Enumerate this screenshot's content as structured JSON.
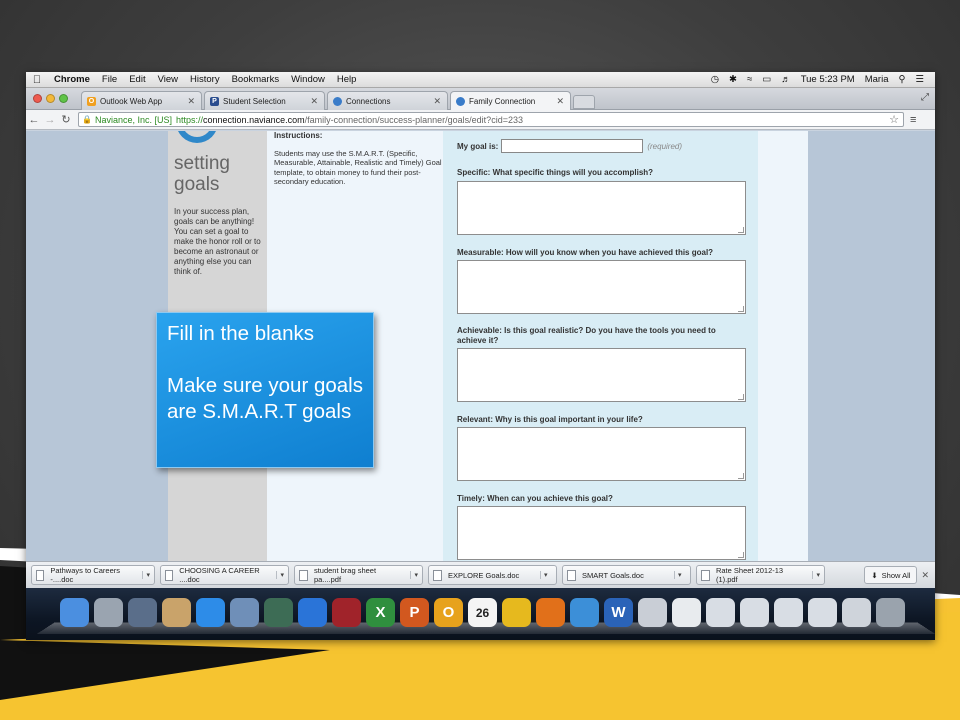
{
  "menubar": {
    "app": "Chrome",
    "items": [
      "File",
      "Edit",
      "View",
      "History",
      "Bookmarks",
      "Window",
      "Help"
    ],
    "clock": "Tue 5:23 PM",
    "user": "Maria"
  },
  "tabs": [
    {
      "label": "Outlook Web App",
      "icon": "outlook-icon",
      "color": "#f0a020"
    },
    {
      "label": "Student Selection",
      "icon": "p-icon",
      "color": "#2a4d8f"
    },
    {
      "label": "Connections",
      "icon": "globe-icon",
      "color": "#3a7cc9"
    },
    {
      "label": "Family Connection",
      "icon": "globe-icon",
      "color": "#3a7cc9"
    }
  ],
  "omnibox": {
    "secure_label": "Naviance, Inc. [US]",
    "scheme": "https://",
    "host": "connection.naviance.com",
    "path": "/family-connection/success-planner/goals/edit?cid=233"
  },
  "sidebar": {
    "heading_line1": "setting",
    "heading_line2": "goals",
    "text": "In your success plan, goals can be anything! You can set a goal to make the honor roll or to become an astronaut or anything else you can think of."
  },
  "instructions": {
    "title": "Instructions:",
    "body": "Students may use the S.M.A.R.T. (Specific, Measurable, Attainable, Realistic and Timely) Goal template, to obtain money to fund their post-secondary education."
  },
  "form": {
    "goal_label": "My goal is:",
    "required": "(required)",
    "questions": [
      "Specific: What specific things will you accomplish?",
      "Measurable: How will you know when you have achieved this goal?",
      "Achievable: Is this goal realistic? Do you have the tools you need to achieve it?",
      "Relevant: Why is this goal important in your life?",
      "Timely: When can you achieve this goal?"
    ]
  },
  "callout": {
    "line1": "Fill in the blanks",
    "line2": "Make sure your goals are S.M.A.R.T goals"
  },
  "downloads": {
    "files": [
      "Pathways to Careers -....doc",
      "CHOOSING A CAREER ....doc",
      "student brag sheet pa....pdf",
      "EXPLORE Goals.doc",
      "SMART Goals.doc",
      "Rate Sheet 2012-13 (1).pdf"
    ],
    "show_all": "Show All"
  },
  "dock": {
    "icons": [
      {
        "name": "finder-icon",
        "color": "#4b8fe0"
      },
      {
        "name": "launchpad-icon",
        "color": "#9aa4b0"
      },
      {
        "name": "mission-control-icon",
        "color": "#5a6e8a"
      },
      {
        "name": "contacts-icon",
        "color": "#c9a36a"
      },
      {
        "name": "app-store-icon",
        "color": "#2d8ce8"
      },
      {
        "name": "preview-icon",
        "color": "#6f8fb8"
      },
      {
        "name": "facetime-icon",
        "color": "#3d6c55"
      },
      {
        "name": "itunes-icon",
        "color": "#2a74d8"
      },
      {
        "name": "photo-booth-icon",
        "color": "#a0232a"
      },
      {
        "name": "excel-icon",
        "color": "#2f8f3e",
        "glyph": "X"
      },
      {
        "name": "powerpoint-icon",
        "color": "#d2581f",
        "glyph": "P"
      },
      {
        "name": "outlook-icon",
        "color": "#e7a21c",
        "glyph": "O"
      },
      {
        "name": "calendar-icon",
        "color": "#f4f4f4",
        "glyph": "26"
      },
      {
        "name": "chrome-icon",
        "color": "#e6b91e"
      },
      {
        "name": "firefox-icon",
        "color": "#e1701a"
      },
      {
        "name": "safari-icon",
        "color": "#3c8fd8"
      },
      {
        "name": "word-icon",
        "color": "#2a63b8",
        "glyph": "W"
      },
      {
        "name": "documents-stack-icon",
        "color": "#c9ced6"
      },
      {
        "name": "document-icon",
        "color": "#e8ebee"
      },
      {
        "name": "document-stack-icon",
        "color": "#d8dde4"
      },
      {
        "name": "document-stack-icon",
        "color": "#d8dde4"
      },
      {
        "name": "document-stack-icon",
        "color": "#d8dde4"
      },
      {
        "name": "document-stack-icon",
        "color": "#d8dde4"
      },
      {
        "name": "downloads-stack-icon",
        "color": "#cfd4db"
      },
      {
        "name": "trash-icon",
        "color": "#9aa3ad"
      }
    ]
  }
}
